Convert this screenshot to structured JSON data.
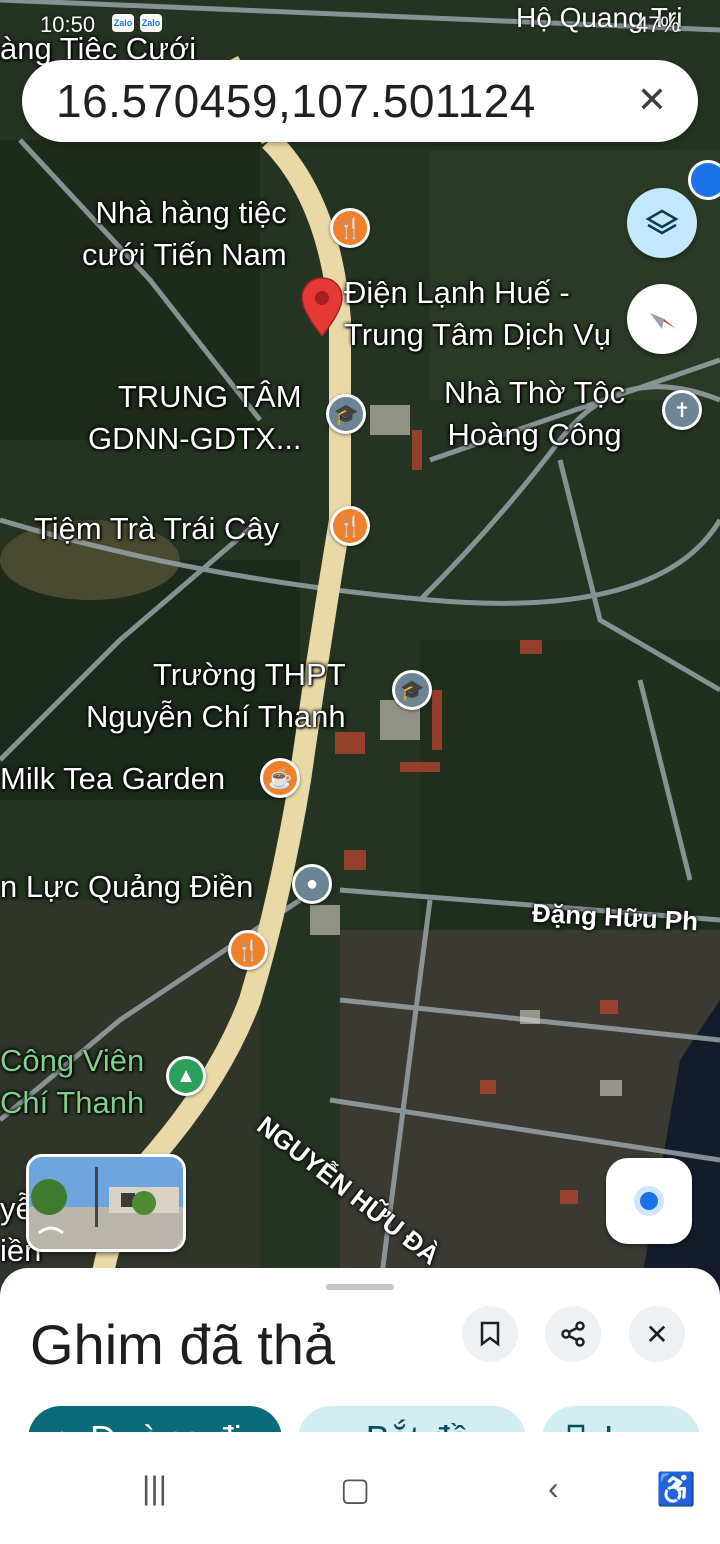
{
  "status": {
    "time": "10:50",
    "apps": [
      "Zalo",
      "Zalo"
    ],
    "battery": "47%",
    "place_overlay": "Hộ Quang Trị"
  },
  "search": {
    "query": "16.570459,107.501124"
  },
  "map_labels": {
    "top_left": "àng Tiệc Cưới",
    "restaurant_tien_nam": "Nhà hàng tiệc\ncưới Tiến Nam",
    "dien_lanh": "Điện Lạnh Huế -\nTrung Tâm Dịch Vụ",
    "trung_tam": "TRUNG TÂM\nGDNN-GDTX...",
    "nha_tho": "Nhà Thờ Tộc\nHoàng Công",
    "tiem_tra": "Tiệm Trà Trái Cây",
    "truong_thpt": "Trường THPT\nNguyễn Chí Thanh",
    "milk_tea": "Milk Tea Garden",
    "dien_luc": "n Lực Quảng Điền",
    "cong_vien": "Công Viên\nChí Thanh",
    "left_edge": "yễ\niền",
    "road_dang": "Đặng Hữu Ph",
    "road_nguyen": "NGUYỄN HỮU ĐÀ"
  },
  "sheet": {
    "title": "Ghim đã thả",
    "chips": {
      "directions": "Đường đi",
      "start": "Bắt đầu",
      "save": "Lưu"
    }
  },
  "colors": {
    "primary_chip": "#0b6b7b",
    "secondary_chip": "#d3eef3",
    "pin": "#e53935",
    "poi_food": "#f0802a",
    "poi_place": "#6d8494",
    "poi_park": "#2aa05a"
  }
}
